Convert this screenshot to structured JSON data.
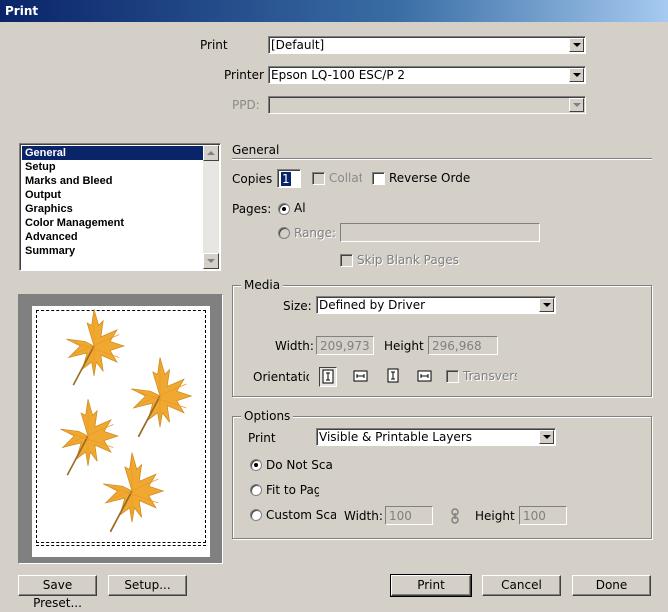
{
  "window": {
    "title": "Print"
  },
  "top": {
    "print_label": "Print",
    "print_value": "[Default]",
    "printer_label": "Printer",
    "printer_value": "Epson LQ-100 ESC/P 2",
    "ppd_label": "PPD:",
    "ppd_value": ""
  },
  "sidebar": {
    "items": [
      {
        "label": "General",
        "selected": true
      },
      {
        "label": "Setup"
      },
      {
        "label": "Marks and Bleed"
      },
      {
        "label": "Output"
      },
      {
        "label": "Graphics"
      },
      {
        "label": "Color Management"
      },
      {
        "label": "Advanced"
      },
      {
        "label": "Summary"
      }
    ]
  },
  "general": {
    "heading": "General",
    "copies_label": "Copies",
    "copies_value": "1",
    "collate_label": "Collate",
    "reverse_label": "Reverse Orde",
    "pages_label": "Pages:",
    "all_label": "Al",
    "range_label": "Range:",
    "range_value": "",
    "skip_blank_label": "Skip Blank Pages"
  },
  "media": {
    "title": "Media",
    "size_label": "Size:",
    "size_value": "Defined by Driver",
    "width_label": "Width:",
    "width_value": "209,973",
    "height_label": "Height",
    "height_value": "296,968",
    "orientation_label": "Orientatio",
    "transverse_label": "Transverse"
  },
  "options": {
    "title": "Options",
    "print_label": "Print",
    "print_value": "Visible & Printable Layers",
    "do_not_scale": "Do Not Scale",
    "fit_to_page": "Fit to Page",
    "custom_scale": "Custom Scale",
    "width_label": "Width:",
    "width_value": "100",
    "height_label": "Height",
    "height_value": "100"
  },
  "buttons": {
    "save_preset": "Save Preset...",
    "setup": "Setup...",
    "print": "Print",
    "cancel": "Cancel",
    "done": "Done"
  },
  "colors": {
    "selection": "#0a246a",
    "leaf": "#f0a830",
    "dialog_bg": "#d4d0c8"
  }
}
